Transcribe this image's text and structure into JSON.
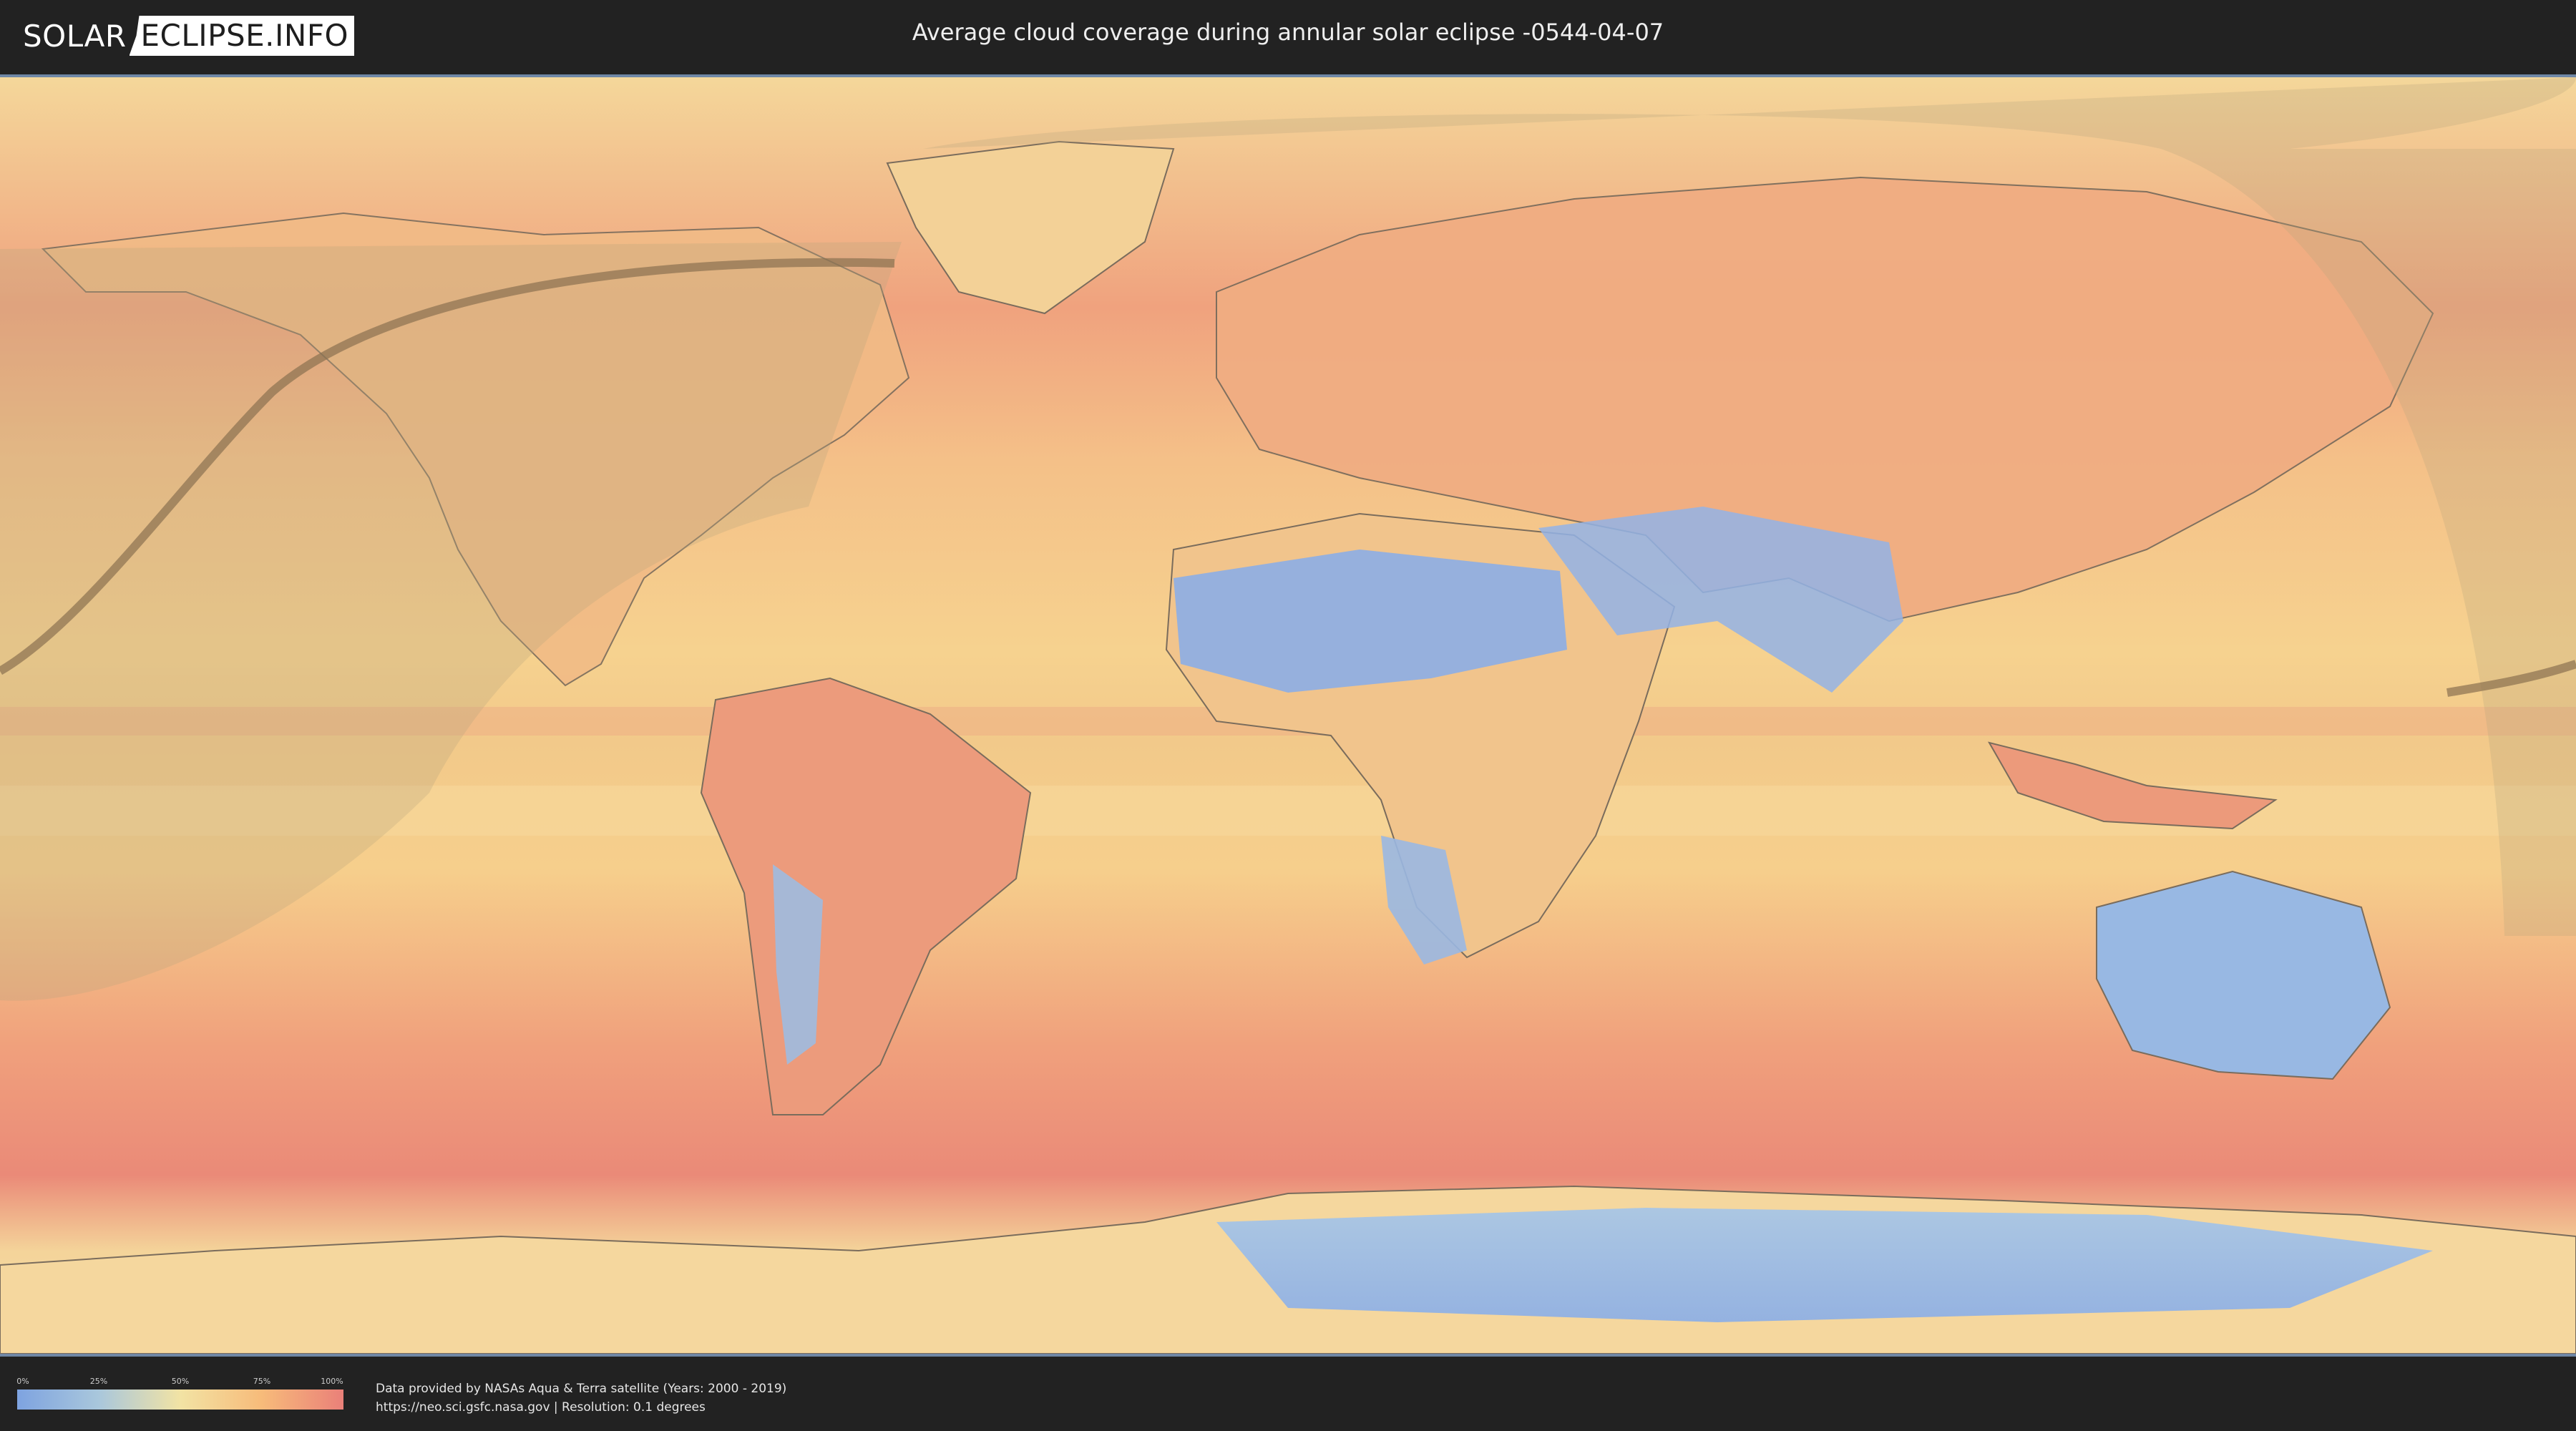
{
  "header": {
    "logo_left": "SOLAR",
    "logo_right": "ECLIPSE.INFO",
    "title": "Average cloud coverage during annular solar eclipse -0544-04-07"
  },
  "legend": {
    "ticks": [
      "0%",
      "25%",
      "50%",
      "75%",
      "100%"
    ],
    "colors": [
      "#7ea3e0",
      "#a9c7dc",
      "#f2e3a4",
      "#f7bb7a",
      "#ea8079"
    ]
  },
  "credits": {
    "line1": "Data provided by NASAs Aqua & Terra satellite (Years: 2000 - 2019)",
    "line2": "https://neo.sci.gsfc.nasa.gov | Resolution: 0.1 degrees"
  },
  "map": {
    "projection": "equirectangular",
    "ocean_color": "#f2c98a",
    "eclipse_visibility_shade": "#b8a57f",
    "annularity_path_color": "#8a7050"
  }
}
